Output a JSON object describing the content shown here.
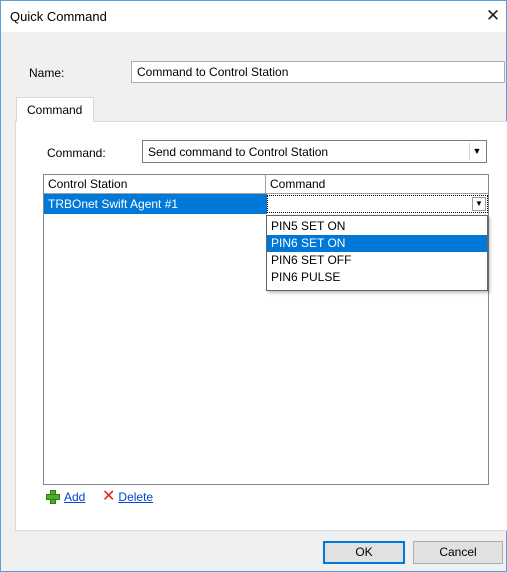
{
  "window": {
    "title": "Quick Command",
    "close_glyph": "✕"
  },
  "name": {
    "label": "Name:",
    "value": "Command to Control Station"
  },
  "tabs": [
    {
      "label": "Command",
      "active": true
    }
  ],
  "command": {
    "label": "Command:",
    "selected": "Send command to Control Station",
    "arrow_icon": "chevron-down-icon"
  },
  "grid": {
    "columns": [
      "Control Station",
      "Command"
    ],
    "rows": [
      {
        "control_station": "TRBOnet Swift Agent #1",
        "command": ""
      }
    ]
  },
  "dropdown": {
    "options": [
      "PIN5 SET ON",
      "PIN6 SET ON",
      "PIN6 SET OFF",
      "PIN6 PULSE"
    ],
    "highlighted": "PIN6 SET ON"
  },
  "actions": {
    "add_label": "Add",
    "delete_label": "Delete"
  },
  "buttons": {
    "ok": "OK",
    "cancel": "Cancel"
  },
  "colors": {
    "selection": "#0078d7",
    "link": "#0044cc",
    "add_icon": "#4caf2a",
    "delete_icon": "#e02020"
  }
}
